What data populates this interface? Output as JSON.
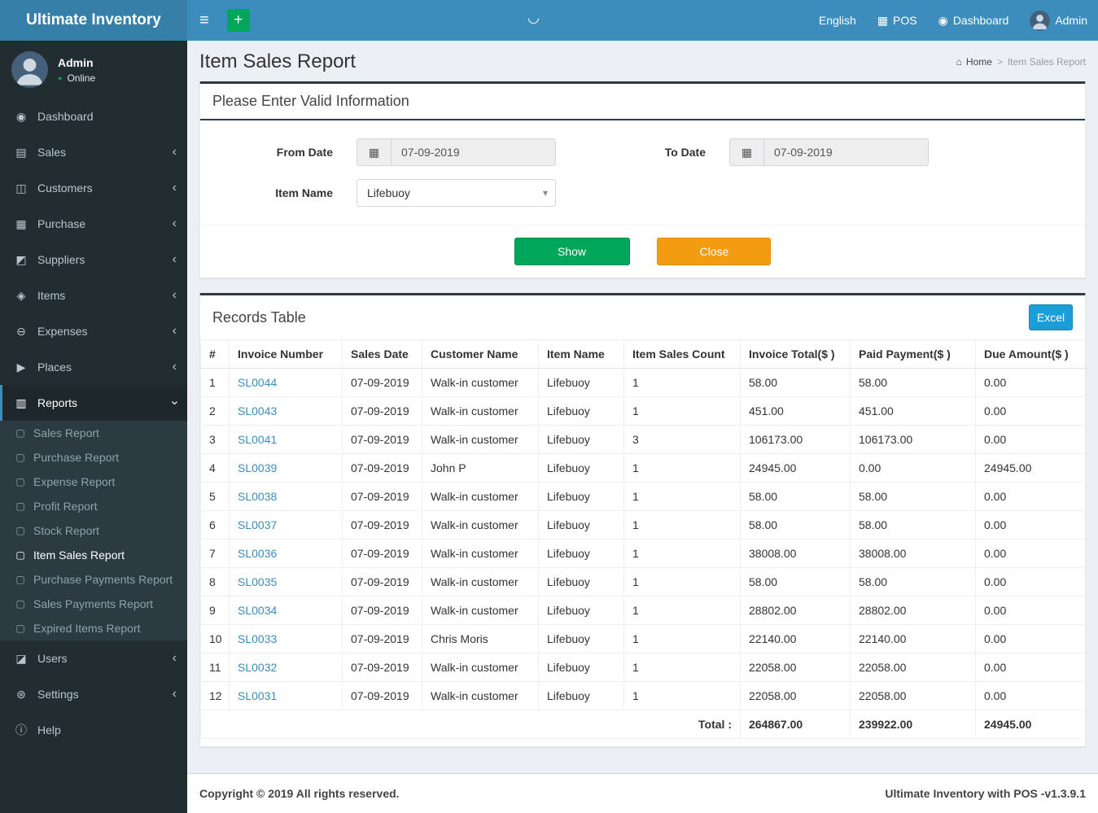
{
  "colors": {
    "navbar": "#3c8dbc",
    "logo_bg": "#367fa9",
    "sidebar_bg": "#222d32",
    "submenu_bg": "#2c3b41",
    "accent_blue": "#3c8dbc",
    "success_green": "#00a65a",
    "warning_orange": "#f39c12",
    "excel_blue": "#1a9ed9",
    "content_bg": "#ecf0f5",
    "header_line": "#2c3b41"
  },
  "icons": {
    "hamburger": "≡",
    "plus": "+",
    "pos": "▦",
    "dashboard": "◉",
    "home": "⌂",
    "calendar": "▦",
    "caret": "▾",
    "arc": "◡",
    "status_dot": "●",
    "breadcrumb_sep": ">"
  },
  "navbar": {
    "brand": "Ultimate Inventory",
    "language": "English",
    "pos_label": "POS",
    "dashboard_label": "Dashboard",
    "user_name": "Admin"
  },
  "sidebar": {
    "user_name": "Admin",
    "user_status": "Online",
    "items": [
      {
        "label": "Dashboard",
        "icon": "◉",
        "chevron": ""
      },
      {
        "label": "Sales",
        "icon": "▤",
        "chevron": "‹"
      },
      {
        "label": "Customers",
        "icon": "◫",
        "chevron": "‹"
      },
      {
        "label": "Purchase",
        "icon": "▦",
        "chevron": "‹"
      },
      {
        "label": "Suppliers",
        "icon": "◩",
        "chevron": "‹"
      },
      {
        "label": "Items",
        "icon": "◈",
        "chevron": "‹"
      },
      {
        "label": "Expenses",
        "icon": "⊖",
        "chevron": "‹"
      },
      {
        "label": "Places",
        "icon": "▶",
        "chevron": "‹"
      },
      {
        "label": "Reports",
        "icon": "▥",
        "chevron": "‹"
      },
      {
        "label": "Users",
        "icon": "◪",
        "chevron": "‹"
      },
      {
        "label": "Settings",
        "icon": "⊛",
        "chevron": "‹"
      },
      {
        "label": "Help",
        "icon": "ⓘ",
        "chevron": ""
      }
    ],
    "reports_submenu": [
      {
        "label": "Sales Report",
        "icon": "▢"
      },
      {
        "label": "Purchase Report",
        "icon": "▢"
      },
      {
        "label": "Expense Report",
        "icon": "▢"
      },
      {
        "label": "Profit Report",
        "icon": "▢"
      },
      {
        "label": "Stock Report",
        "icon": "▢"
      },
      {
        "label": "Item Sales Report",
        "icon": "▢"
      },
      {
        "label": "Purchase Payments Report",
        "icon": "▢"
      },
      {
        "label": "Sales Payments Report",
        "icon": "▢"
      },
      {
        "label": "Expired Items Report",
        "icon": "▢"
      }
    ]
  },
  "page": {
    "title": "Item Sales Report",
    "breadcrumb_home": "Home",
    "breadcrumb_current": "Item Sales Report"
  },
  "filter": {
    "title": "Please Enter Valid Information",
    "from_date_label": "From Date",
    "from_date_value": "07-09-2019",
    "to_date_label": "To Date",
    "to_date_value": "07-09-2019",
    "item_name_label": "Item Name",
    "item_name_value": "Lifebuoy",
    "show_label": "Show",
    "close_label": "Close"
  },
  "records": {
    "title": "Records Table",
    "excel_label": "Excel",
    "columns": [
      "#",
      "Invoice Number",
      "Sales Date",
      "Customer Name",
      "Item Name",
      "Item Sales Count",
      "Invoice Total($ )",
      "Paid Payment($ )",
      "Due Amount($ )"
    ],
    "rows": [
      {
        "num": "1",
        "invoice": "SL0044",
        "date": "07-09-2019",
        "customer": "Walk-in customer",
        "item": "Lifebuoy",
        "count": "1",
        "total": "58.00",
        "paid": "58.00",
        "due": "0.00"
      },
      {
        "num": "2",
        "invoice": "SL0043",
        "date": "07-09-2019",
        "customer": "Walk-in customer",
        "item": "Lifebuoy",
        "count": "1",
        "total": "451.00",
        "paid": "451.00",
        "due": "0.00"
      },
      {
        "num": "3",
        "invoice": "SL0041",
        "date": "07-09-2019",
        "customer": "Walk-in customer",
        "item": "Lifebuoy",
        "count": "3",
        "total": "106173.00",
        "paid": "106173.00",
        "due": "0.00"
      },
      {
        "num": "4",
        "invoice": "SL0039",
        "date": "07-09-2019",
        "customer": "John P",
        "item": "Lifebuoy",
        "count": "1",
        "total": "24945.00",
        "paid": "0.00",
        "due": "24945.00"
      },
      {
        "num": "5",
        "invoice": "SL0038",
        "date": "07-09-2019",
        "customer": "Walk-in customer",
        "item": "Lifebuoy",
        "count": "1",
        "total": "58.00",
        "paid": "58.00",
        "due": "0.00"
      },
      {
        "num": "6",
        "invoice": "SL0037",
        "date": "07-09-2019",
        "customer": "Walk-in customer",
        "item": "Lifebuoy",
        "count": "1",
        "total": "58.00",
        "paid": "58.00",
        "due": "0.00"
      },
      {
        "num": "7",
        "invoice": "SL0036",
        "date": "07-09-2019",
        "customer": "Walk-in customer",
        "item": "Lifebuoy",
        "count": "1",
        "total": "38008.00",
        "paid": "38008.00",
        "due": "0.00"
      },
      {
        "num": "8",
        "invoice": "SL0035",
        "date": "07-09-2019",
        "customer": "Walk-in customer",
        "item": "Lifebuoy",
        "count": "1",
        "total": "58.00",
        "paid": "58.00",
        "due": "0.00"
      },
      {
        "num": "9",
        "invoice": "SL0034",
        "date": "07-09-2019",
        "customer": "Walk-in customer",
        "item": "Lifebuoy",
        "count": "1",
        "total": "28802.00",
        "paid": "28802.00",
        "due": "0.00"
      },
      {
        "num": "10",
        "invoice": "SL0033",
        "date": "07-09-2019",
        "customer": "Chris Moris",
        "item": "Lifebuoy",
        "count": "1",
        "total": "22140.00",
        "paid": "22140.00",
        "due": "0.00"
      },
      {
        "num": "11",
        "invoice": "SL0032",
        "date": "07-09-2019",
        "customer": "Walk-in customer",
        "item": "Lifebuoy",
        "count": "1",
        "total": "22058.00",
        "paid": "22058.00",
        "due": "0.00"
      },
      {
        "num": "12",
        "invoice": "SL0031",
        "date": "07-09-2019",
        "customer": "Walk-in customer",
        "item": "Lifebuoy",
        "count": "1",
        "total": "22058.00",
        "paid": "22058.00",
        "due": "0.00"
      }
    ],
    "total_label": "Total :",
    "total_invoice": "264867.00",
    "total_paid": "239922.00",
    "total_due": "24945.00"
  },
  "footer": {
    "copyright": "Copyright © 2019 All rights reserved.",
    "version": "Ultimate Inventory with POS -v1.3.9.1"
  }
}
